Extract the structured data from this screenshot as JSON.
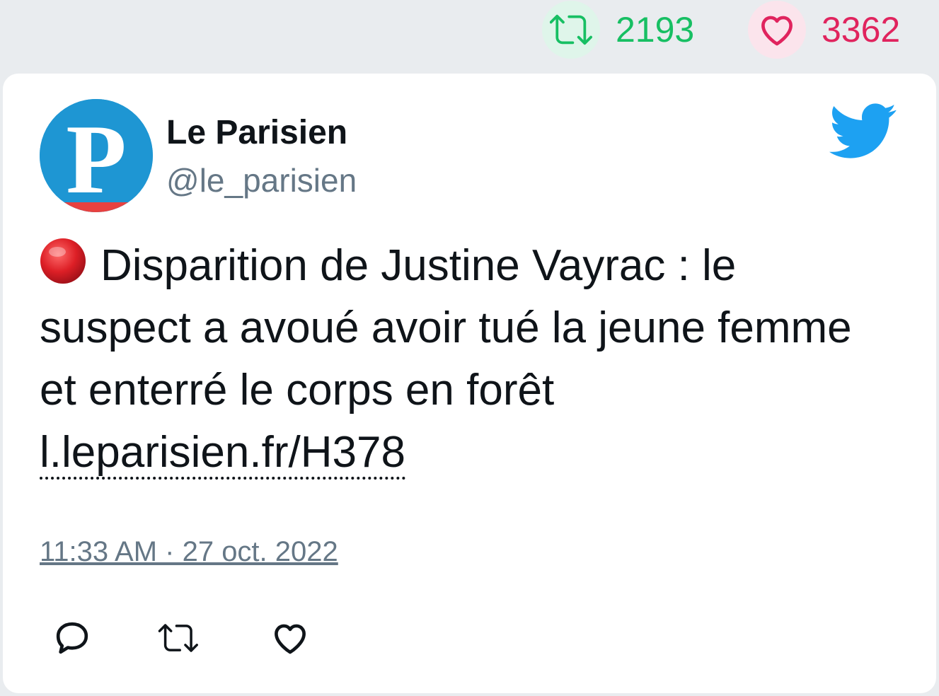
{
  "stats": {
    "retweets": "2193",
    "likes": "3362"
  },
  "author": {
    "name": "Le Parisien",
    "handle": "@le_parisien",
    "avatar_letter": "P"
  },
  "tweet": {
    "text": "Disparition de Justine Vayrac : le suspect a avoué avoir tué la jeune femme et enterré le corps en forêt",
    "link": "l.leparisien.fr/H378",
    "timestamp": "11:33 AM · 27 oct. 2022"
  },
  "icons": {
    "retweet_stat": "retweet-icon",
    "like_stat": "heart-icon",
    "brand": "twitter-bird-icon",
    "status": "red-circle-icon",
    "reply": "reply-icon",
    "retweet": "retweet-icon",
    "like": "heart-icon"
  },
  "colors": {
    "retweet": "#17bf63",
    "like": "#e0245e",
    "twitter_blue": "#1da1f2",
    "avatar_bg": "#1e96d3",
    "avatar_stripe": "#e8413f"
  }
}
